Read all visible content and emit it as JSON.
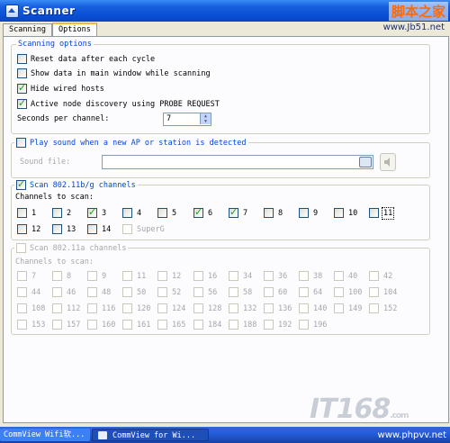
{
  "window": {
    "title": "Scanner"
  },
  "watermark": {
    "site_title": "脚本之家",
    "site_url": "www.Jb51.net",
    "logo": "IT168",
    "logo_suffix": ".com",
    "bottom_url": "www.phpvv.net"
  },
  "tabs": [
    {
      "label": "Scanning"
    },
    {
      "label": "Options"
    }
  ],
  "scanning_options": {
    "legend": "Scanning options",
    "reset_data": {
      "label": "Reset data after each cycle",
      "checked": false
    },
    "show_data": {
      "label": "Show data in main window while scanning",
      "checked": false
    },
    "hide_wired": {
      "label": "Hide wired hosts",
      "checked": true
    },
    "active_discovery": {
      "label": "Active node discovery using PROBE REQUEST",
      "checked": true
    },
    "seconds_label": "Seconds per channel:",
    "seconds_value": "7"
  },
  "sound": {
    "legend": "Play sound when a new AP or station is detected",
    "checked": false,
    "file_label": "Sound file:",
    "file_value": ""
  },
  "bg": {
    "legend": "Scan 802.11b/g channels",
    "checked": true,
    "channels_label": "Channels to scan:",
    "channels": [
      {
        "label": "1",
        "checked": false
      },
      {
        "label": "2",
        "checked": false
      },
      {
        "label": "3",
        "checked": true
      },
      {
        "label": "4",
        "checked": false
      },
      {
        "label": "5",
        "checked": false
      },
      {
        "label": "6",
        "checked": true
      },
      {
        "label": "7",
        "checked": true
      },
      {
        "label": "8",
        "checked": false
      },
      {
        "label": "9",
        "checked": false
      },
      {
        "label": "10",
        "checked": false
      },
      {
        "label": "11",
        "checked": false
      },
      {
        "label": "12",
        "checked": false
      },
      {
        "label": "13",
        "checked": false
      },
      {
        "label": "14",
        "checked": false
      },
      {
        "label": "SuperG",
        "checked": false
      }
    ]
  },
  "a": {
    "legend": "Scan 802.11a channels",
    "checked": false,
    "channels_label": "Channels to scan:",
    "channels": [
      "7",
      "8",
      "9",
      "11",
      "12",
      "16",
      "34",
      "36",
      "38",
      "40",
      "42",
      "44",
      "46",
      "48",
      "50",
      "52",
      "56",
      "58",
      "60",
      "64",
      "100",
      "104",
      "108",
      "112",
      "116",
      "120",
      "124",
      "128",
      "132",
      "136",
      "140",
      "149",
      "152",
      "153",
      "157",
      "160",
      "161",
      "165",
      "184",
      "188",
      "192",
      "196"
    ]
  },
  "taskbar": {
    "items": [
      {
        "label": "CommView Wifi软..."
      },
      {
        "label": "CommView for Wi..."
      }
    ]
  }
}
